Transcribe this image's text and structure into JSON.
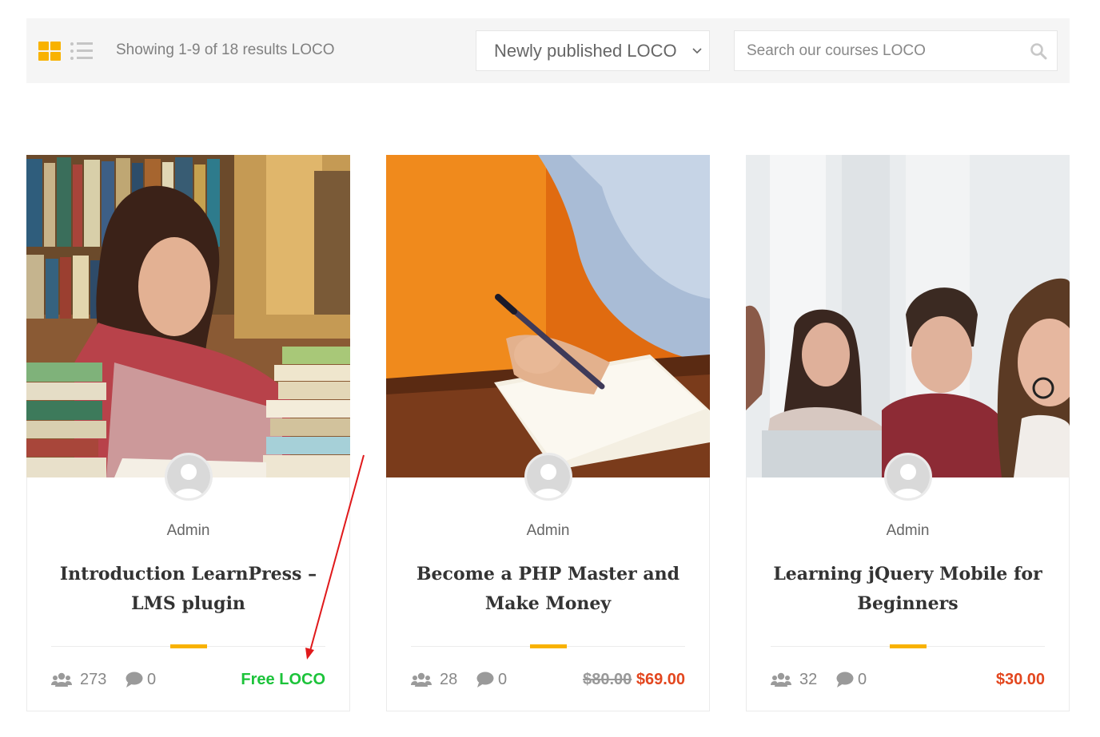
{
  "toolbar": {
    "results_text": "Showing 1-9 of 18 results LOCO",
    "sort_selected": "Newly published LOCO",
    "search_placeholder": "Search our courses LOCO",
    "accent_color": "#f8b200"
  },
  "courses": [
    {
      "author": "Admin",
      "title_line1": "Introduction LearnPress –",
      "title_line2": "LMS plugin",
      "students": "273",
      "comments": "0",
      "price_label": "Free LOCO",
      "price_color": "#1cc33a"
    },
    {
      "author": "Admin",
      "title_line1": "Become a PHP Master and",
      "title_line2": "Make Money",
      "students": "28",
      "comments": "0",
      "old_price": "$80.00",
      "price_label": "$69.00",
      "price_color": "#e3471f"
    },
    {
      "author": "Admin",
      "title_line1": "Learning jQuery Mobile for",
      "title_line2": "Beginners",
      "students": "32",
      "comments": "0",
      "price_label": "$30.00",
      "price_color": "#e3471f"
    }
  ],
  "annotation_color": "#e0191b"
}
